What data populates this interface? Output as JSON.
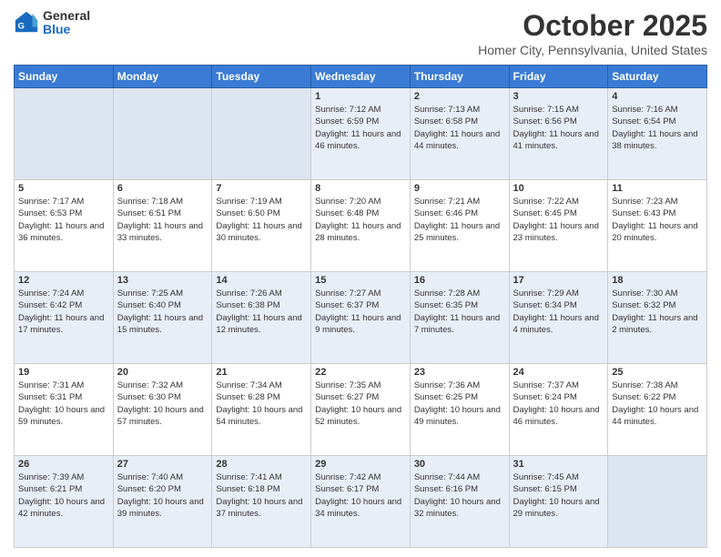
{
  "logo": {
    "general": "General",
    "blue": "Blue"
  },
  "title": "October 2025",
  "location": "Homer City, Pennsylvania, United States",
  "days_of_week": [
    "Sunday",
    "Monday",
    "Tuesday",
    "Wednesday",
    "Thursday",
    "Friday",
    "Saturday"
  ],
  "weeks": [
    {
      "row_class": "row-odd",
      "days": [
        {
          "date": "",
          "empty": true
        },
        {
          "date": "",
          "empty": true
        },
        {
          "date": "",
          "empty": true
        },
        {
          "date": "1",
          "sunrise": "7:12 AM",
          "sunset": "6:59 PM",
          "daylight": "11 hours and 46 minutes."
        },
        {
          "date": "2",
          "sunrise": "7:13 AM",
          "sunset": "6:58 PM",
          "daylight": "11 hours and 44 minutes."
        },
        {
          "date": "3",
          "sunrise": "7:15 AM",
          "sunset": "6:56 PM",
          "daylight": "11 hours and 41 minutes."
        },
        {
          "date": "4",
          "sunrise": "7:16 AM",
          "sunset": "6:54 PM",
          "daylight": "11 hours and 38 minutes."
        }
      ]
    },
    {
      "row_class": "row-even",
      "days": [
        {
          "date": "5",
          "sunrise": "7:17 AM",
          "sunset": "6:53 PM",
          "daylight": "11 hours and 36 minutes."
        },
        {
          "date": "6",
          "sunrise": "7:18 AM",
          "sunset": "6:51 PM",
          "daylight": "11 hours and 33 minutes."
        },
        {
          "date": "7",
          "sunrise": "7:19 AM",
          "sunset": "6:50 PM",
          "daylight": "11 hours and 30 minutes."
        },
        {
          "date": "8",
          "sunrise": "7:20 AM",
          "sunset": "6:48 PM",
          "daylight": "11 hours and 28 minutes."
        },
        {
          "date": "9",
          "sunrise": "7:21 AM",
          "sunset": "6:46 PM",
          "daylight": "11 hours and 25 minutes."
        },
        {
          "date": "10",
          "sunrise": "7:22 AM",
          "sunset": "6:45 PM",
          "daylight": "11 hours and 23 minutes."
        },
        {
          "date": "11",
          "sunrise": "7:23 AM",
          "sunset": "6:43 PM",
          "daylight": "11 hours and 20 minutes."
        }
      ]
    },
    {
      "row_class": "row-odd",
      "days": [
        {
          "date": "12",
          "sunrise": "7:24 AM",
          "sunset": "6:42 PM",
          "daylight": "11 hours and 17 minutes."
        },
        {
          "date": "13",
          "sunrise": "7:25 AM",
          "sunset": "6:40 PM",
          "daylight": "11 hours and 15 minutes."
        },
        {
          "date": "14",
          "sunrise": "7:26 AM",
          "sunset": "6:38 PM",
          "daylight": "11 hours and 12 minutes."
        },
        {
          "date": "15",
          "sunrise": "7:27 AM",
          "sunset": "6:37 PM",
          "daylight": "11 hours and 9 minutes."
        },
        {
          "date": "16",
          "sunrise": "7:28 AM",
          "sunset": "6:35 PM",
          "daylight": "11 hours and 7 minutes."
        },
        {
          "date": "17",
          "sunrise": "7:29 AM",
          "sunset": "6:34 PM",
          "daylight": "11 hours and 4 minutes."
        },
        {
          "date": "18",
          "sunrise": "7:30 AM",
          "sunset": "6:32 PM",
          "daylight": "11 hours and 2 minutes."
        }
      ]
    },
    {
      "row_class": "row-even",
      "days": [
        {
          "date": "19",
          "sunrise": "7:31 AM",
          "sunset": "6:31 PM",
          "daylight": "10 hours and 59 minutes."
        },
        {
          "date": "20",
          "sunrise": "7:32 AM",
          "sunset": "6:30 PM",
          "daylight": "10 hours and 57 minutes."
        },
        {
          "date": "21",
          "sunrise": "7:34 AM",
          "sunset": "6:28 PM",
          "daylight": "10 hours and 54 minutes."
        },
        {
          "date": "22",
          "sunrise": "7:35 AM",
          "sunset": "6:27 PM",
          "daylight": "10 hours and 52 minutes."
        },
        {
          "date": "23",
          "sunrise": "7:36 AM",
          "sunset": "6:25 PM",
          "daylight": "10 hours and 49 minutes."
        },
        {
          "date": "24",
          "sunrise": "7:37 AM",
          "sunset": "6:24 PM",
          "daylight": "10 hours and 46 minutes."
        },
        {
          "date": "25",
          "sunrise": "7:38 AM",
          "sunset": "6:22 PM",
          "daylight": "10 hours and 44 minutes."
        }
      ]
    },
    {
      "row_class": "row-odd",
      "days": [
        {
          "date": "26",
          "sunrise": "7:39 AM",
          "sunset": "6:21 PM",
          "daylight": "10 hours and 42 minutes."
        },
        {
          "date": "27",
          "sunrise": "7:40 AM",
          "sunset": "6:20 PM",
          "daylight": "10 hours and 39 minutes."
        },
        {
          "date": "28",
          "sunrise": "7:41 AM",
          "sunset": "6:18 PM",
          "daylight": "10 hours and 37 minutes."
        },
        {
          "date": "29",
          "sunrise": "7:42 AM",
          "sunset": "6:17 PM",
          "daylight": "10 hours and 34 minutes."
        },
        {
          "date": "30",
          "sunrise": "7:44 AM",
          "sunset": "6:16 PM",
          "daylight": "10 hours and 32 minutes."
        },
        {
          "date": "31",
          "sunrise": "7:45 AM",
          "sunset": "6:15 PM",
          "daylight": "10 hours and 29 minutes."
        },
        {
          "date": "",
          "empty": true
        }
      ]
    }
  ]
}
